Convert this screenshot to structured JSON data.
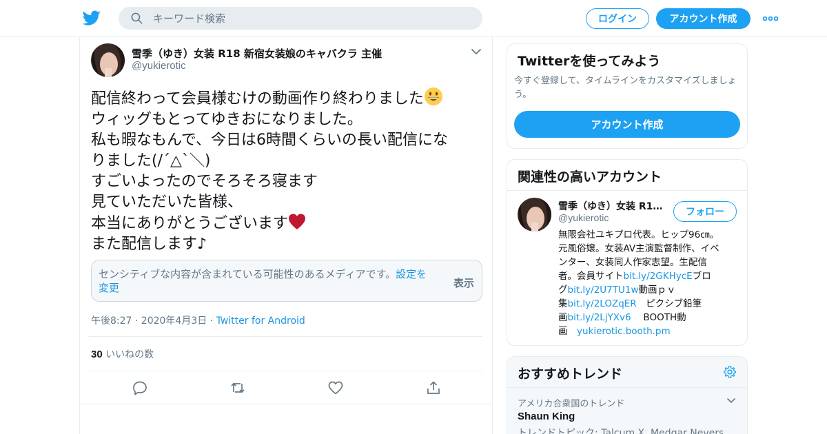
{
  "header": {
    "search_placeholder": "キーワード検索",
    "login_label": "ログイン",
    "signup_label": "アカウント作成"
  },
  "tweet": {
    "author_name": "雪季（ゆき）女装 R18 新宿女装娘のキャバクラ 主催",
    "author_handle": "@yukierotic",
    "lines": [
      "配信終わって会員様むけの動画作り終わりました",
      "ウィッグもとってゆきおになりました。",
      "私も暇なもんで、今日は6時間くらいの長い配信にな",
      "りました(/´△`＼)",
      "すごいよったのでそろそろ寝ます",
      "見ていただいた皆様、",
      "本当にありがとうございます",
      "また配信します♪"
    ],
    "sensitive_message": "センシティブな内容が含まれている可能性のあるメディアです。",
    "sensitive_link": "設定を変更",
    "show_label": "表示",
    "timestamp": "午後8:27 · 2020年4月3日 · ",
    "source": "Twitter for Android",
    "like_count": "30",
    "like_label": "いいねの数"
  },
  "sidebar": {
    "try_title": "Twitterを使ってみよう",
    "try_desc": "今すぐ登録して、タイムラインをカスタマイズしましょう。",
    "try_button": "アカウント作成",
    "related_title": "関連性の高いアカウント",
    "related": {
      "name": "雪季（ゆき）女装 R18 新宿女装娘のキャバクラ 主催",
      "handle": "@yukierotic",
      "follow_label": "フォロー",
      "bio_1": "無限会社ユキプロ代表。ヒップ96㎝。",
      "bio_2": "元風俗嬢。女装AV主演監督制作、イベ",
      "bio_3": "ンター、女装同人作家志望。生配信",
      "bio_4a": "者。会員サイト",
      "bio_4b": "bit.ly/2GKHycE",
      "bio_4c": "ブロ",
      "bio_5a": "グ",
      "bio_5b": "bit.ly/2U7TU1w",
      "bio_5c": "動画ｐｖ",
      "bio_6a": "集",
      "bio_6b": "bit.ly/2LOZqER",
      "bio_6c": "　ピクシブ鉛筆",
      "bio_7a": "画",
      "bio_7b": "bit.ly/2LjYXv6",
      "bio_7c": "　 BOOTH動",
      "bio_8a": "画　",
      "bio_8b": "yukierotic.booth.pm"
    },
    "trends_title": "おすすめトレンド",
    "trend_location": "アメリカ合衆国のトレンド",
    "trend_name": "Shaun King",
    "trend_topic": "トレンドトピック: Talcum X, Medgar Nevers"
  },
  "colors": {
    "brand": "#1da1f2",
    "link": "#1b95e0",
    "muted": "#657786"
  },
  "icons": [
    "twitter-bird-icon",
    "search-icon",
    "more-dots-icon",
    "chevron-down-icon",
    "reply-icon",
    "retweet-icon",
    "like-icon",
    "share-icon",
    "gear-icon",
    "grinning-face-emoji",
    "red-heart-emoji"
  ]
}
